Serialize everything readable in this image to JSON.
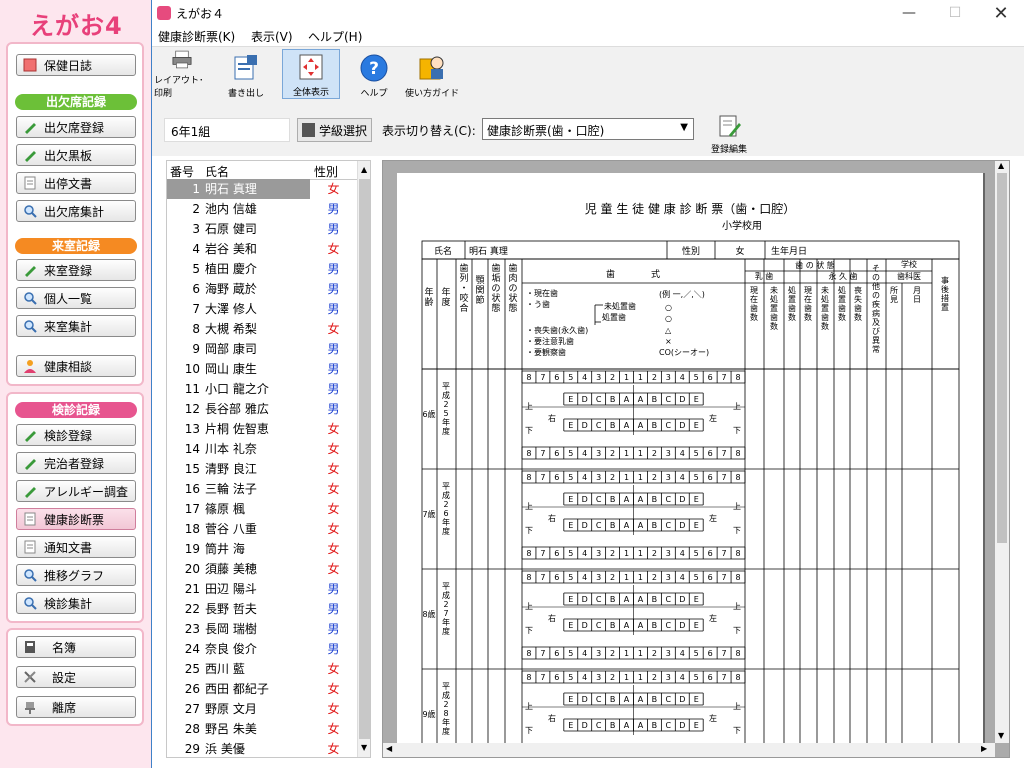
{
  "app": {
    "logo": "えがお4",
    "title": "えがお４"
  },
  "colors": {
    "accent": "#e7558f",
    "green": "#6cc038",
    "orange": "#f58a22"
  },
  "nav": {
    "hoken": "保健日誌",
    "attendance": {
      "header": "出欠席記録",
      "items": [
        "出欠席登録",
        "出欠黒板",
        "出停文書",
        "出欠席集計"
      ]
    },
    "visit": {
      "header": "来室記録",
      "items": [
        "来室登録",
        "個人一覧",
        "来室集計"
      ]
    },
    "consult": "健康相談",
    "checkup": {
      "header": "検診記録",
      "items": [
        "検診登録",
        "完治者登録",
        "アレルギー調査",
        "健康診断票",
        "通知文書",
        "推移グラフ",
        "検診集計"
      ]
    },
    "bottom": [
      "名簿",
      "設定",
      "離席"
    ]
  },
  "menu": [
    "健康診断票(K)",
    "表示(V)",
    "ヘルプ(H)"
  ],
  "toolbar": [
    "レイアウト･印刷",
    "書き出し",
    "全体表示",
    "ヘルプ",
    "使い方ガイド"
  ],
  "controls": {
    "class_value": "6年1組",
    "class_select": "学級選択",
    "switch_label": "表示切り替え(C):",
    "switch_value": "健康診断票(歯・口腔)",
    "register_edit": "登録編集"
  },
  "list": {
    "headers": [
      "番号",
      "氏名",
      "性別"
    ],
    "rows": [
      {
        "no": "1",
        "name": "明石 真理",
        "sex": "女"
      },
      {
        "no": "2",
        "name": "池内 信雄",
        "sex": "男"
      },
      {
        "no": "3",
        "name": "石原 健司",
        "sex": "男"
      },
      {
        "no": "4",
        "name": "岩谷 美和",
        "sex": "女"
      },
      {
        "no": "5",
        "name": "植田 慶介",
        "sex": "男"
      },
      {
        "no": "6",
        "name": "海野 蔵於",
        "sex": "男"
      },
      {
        "no": "7",
        "name": "大澤 修人",
        "sex": "男"
      },
      {
        "no": "8",
        "name": "大槻 希梨",
        "sex": "女"
      },
      {
        "no": "9",
        "name": "岡部 康司",
        "sex": "男"
      },
      {
        "no": "10",
        "name": "岡山 康生",
        "sex": "男"
      },
      {
        "no": "11",
        "name": "小口 龍之介",
        "sex": "男"
      },
      {
        "no": "12",
        "name": "長谷部 雅広",
        "sex": "男"
      },
      {
        "no": "13",
        "name": "片桐 佐智恵",
        "sex": "女"
      },
      {
        "no": "14",
        "name": "川本 礼奈",
        "sex": "女"
      },
      {
        "no": "15",
        "name": "清野 良江",
        "sex": "女"
      },
      {
        "no": "16",
        "name": "三輪 法子",
        "sex": "女"
      },
      {
        "no": "17",
        "name": "篠原 楓",
        "sex": "女"
      },
      {
        "no": "18",
        "name": "菅谷 八重",
        "sex": "女"
      },
      {
        "no": "19",
        "name": "筒井 海",
        "sex": "女"
      },
      {
        "no": "20",
        "name": "須藤 美穂",
        "sex": "女"
      },
      {
        "no": "21",
        "name": "田辺 陽斗",
        "sex": "男"
      },
      {
        "no": "22",
        "name": "長野 哲夫",
        "sex": "男"
      },
      {
        "no": "23",
        "name": "長岡 瑞樹",
        "sex": "男"
      },
      {
        "no": "24",
        "name": "奈良 俊介",
        "sex": "男"
      },
      {
        "no": "25",
        "name": "西川 藍",
        "sex": "女"
      },
      {
        "no": "26",
        "name": "西田 都紀子",
        "sex": "女"
      },
      {
        "no": "27",
        "name": "野原 文月",
        "sex": "女"
      },
      {
        "no": "28",
        "name": "野呂 朱美",
        "sex": "女"
      },
      {
        "no": "29",
        "name": "浜 美優",
        "sex": "女"
      }
    ]
  },
  "form": {
    "title": "児 童 生 徒 健 康 診 断 票（歯・口腔）",
    "subtitle": "小学校用",
    "name_label": "氏名",
    "name_value": "明石 真理",
    "sex_label": "性別",
    "sex_value": "女",
    "birth_label": "生年月日",
    "col_age": "年齢",
    "col_year": "年度",
    "col_bite": "歯列・咬合",
    "col_jaw": "顎関節",
    "col_plaque": "歯垢の状態",
    "col_gum": "歯肉の状態",
    "teeth_header": "歯　　　　式",
    "legend": [
      "・現在歯",
      "・う歯",
      "・喪失歯(永久歯)",
      "・要注意乳歯",
      "・要観察歯"
    ],
    "legend_sub": [
      "未処置歯",
      "処置歯"
    ],
    "legend_marks": [
      "(例 一,／,＼)",
      "○",
      "○",
      "△",
      "×",
      "CO(シーオー)"
    ],
    "state_header": "歯 の 状 態",
    "baby": "乳 歯",
    "perm": "永 久 歯",
    "state_cols": [
      "現在歯数",
      "未処置歯数",
      "処置歯数",
      "現在歯数",
      "未処置歯数",
      "処置歯数",
      "喪失歯数"
    ],
    "other": "その他の疾病及び異常",
    "school_doc": "学校歯科医",
    "doc_sub": [
      "所見",
      "月日"
    ],
    "after": "事後措置",
    "upper": "上",
    "lower": "下",
    "right": "右",
    "left": "左",
    "perm_nums": [
      "8",
      "7",
      "6",
      "5",
      "4",
      "3",
      "2",
      "1",
      "1",
      "2",
      "3",
      "4",
      "5",
      "6",
      "7",
      "8"
    ],
    "baby_nums": [
      "E",
      "D",
      "C",
      "B",
      "A",
      "A",
      "B",
      "C",
      "D",
      "E"
    ],
    "years": [
      {
        "age": "6歳",
        "era": "平成25年度"
      },
      {
        "age": "7歳",
        "era": "平成26年度"
      },
      {
        "age": "8歳",
        "era": "平成27年度"
      },
      {
        "age": "9歳",
        "era": "平成28年度"
      }
    ]
  }
}
